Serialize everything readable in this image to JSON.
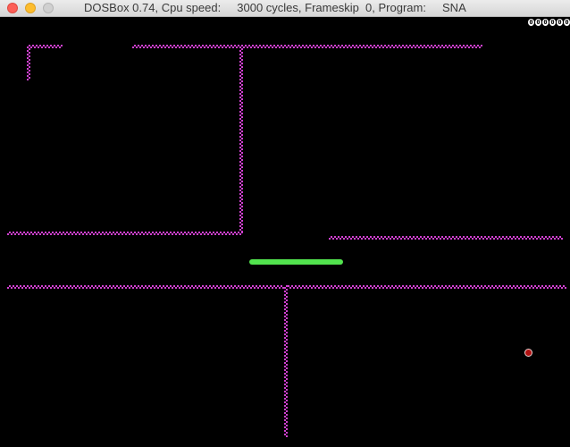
{
  "window": {
    "title": "DOSBox 0.74, Cpu speed:     3000 cycles, Frameskip  0, Program:     SNA"
  },
  "game": {
    "score": "000000",
    "colors": {
      "background": "#000000",
      "wall": "#d040d0",
      "snake": "#52e34e",
      "food": "#b01010"
    }
  }
}
